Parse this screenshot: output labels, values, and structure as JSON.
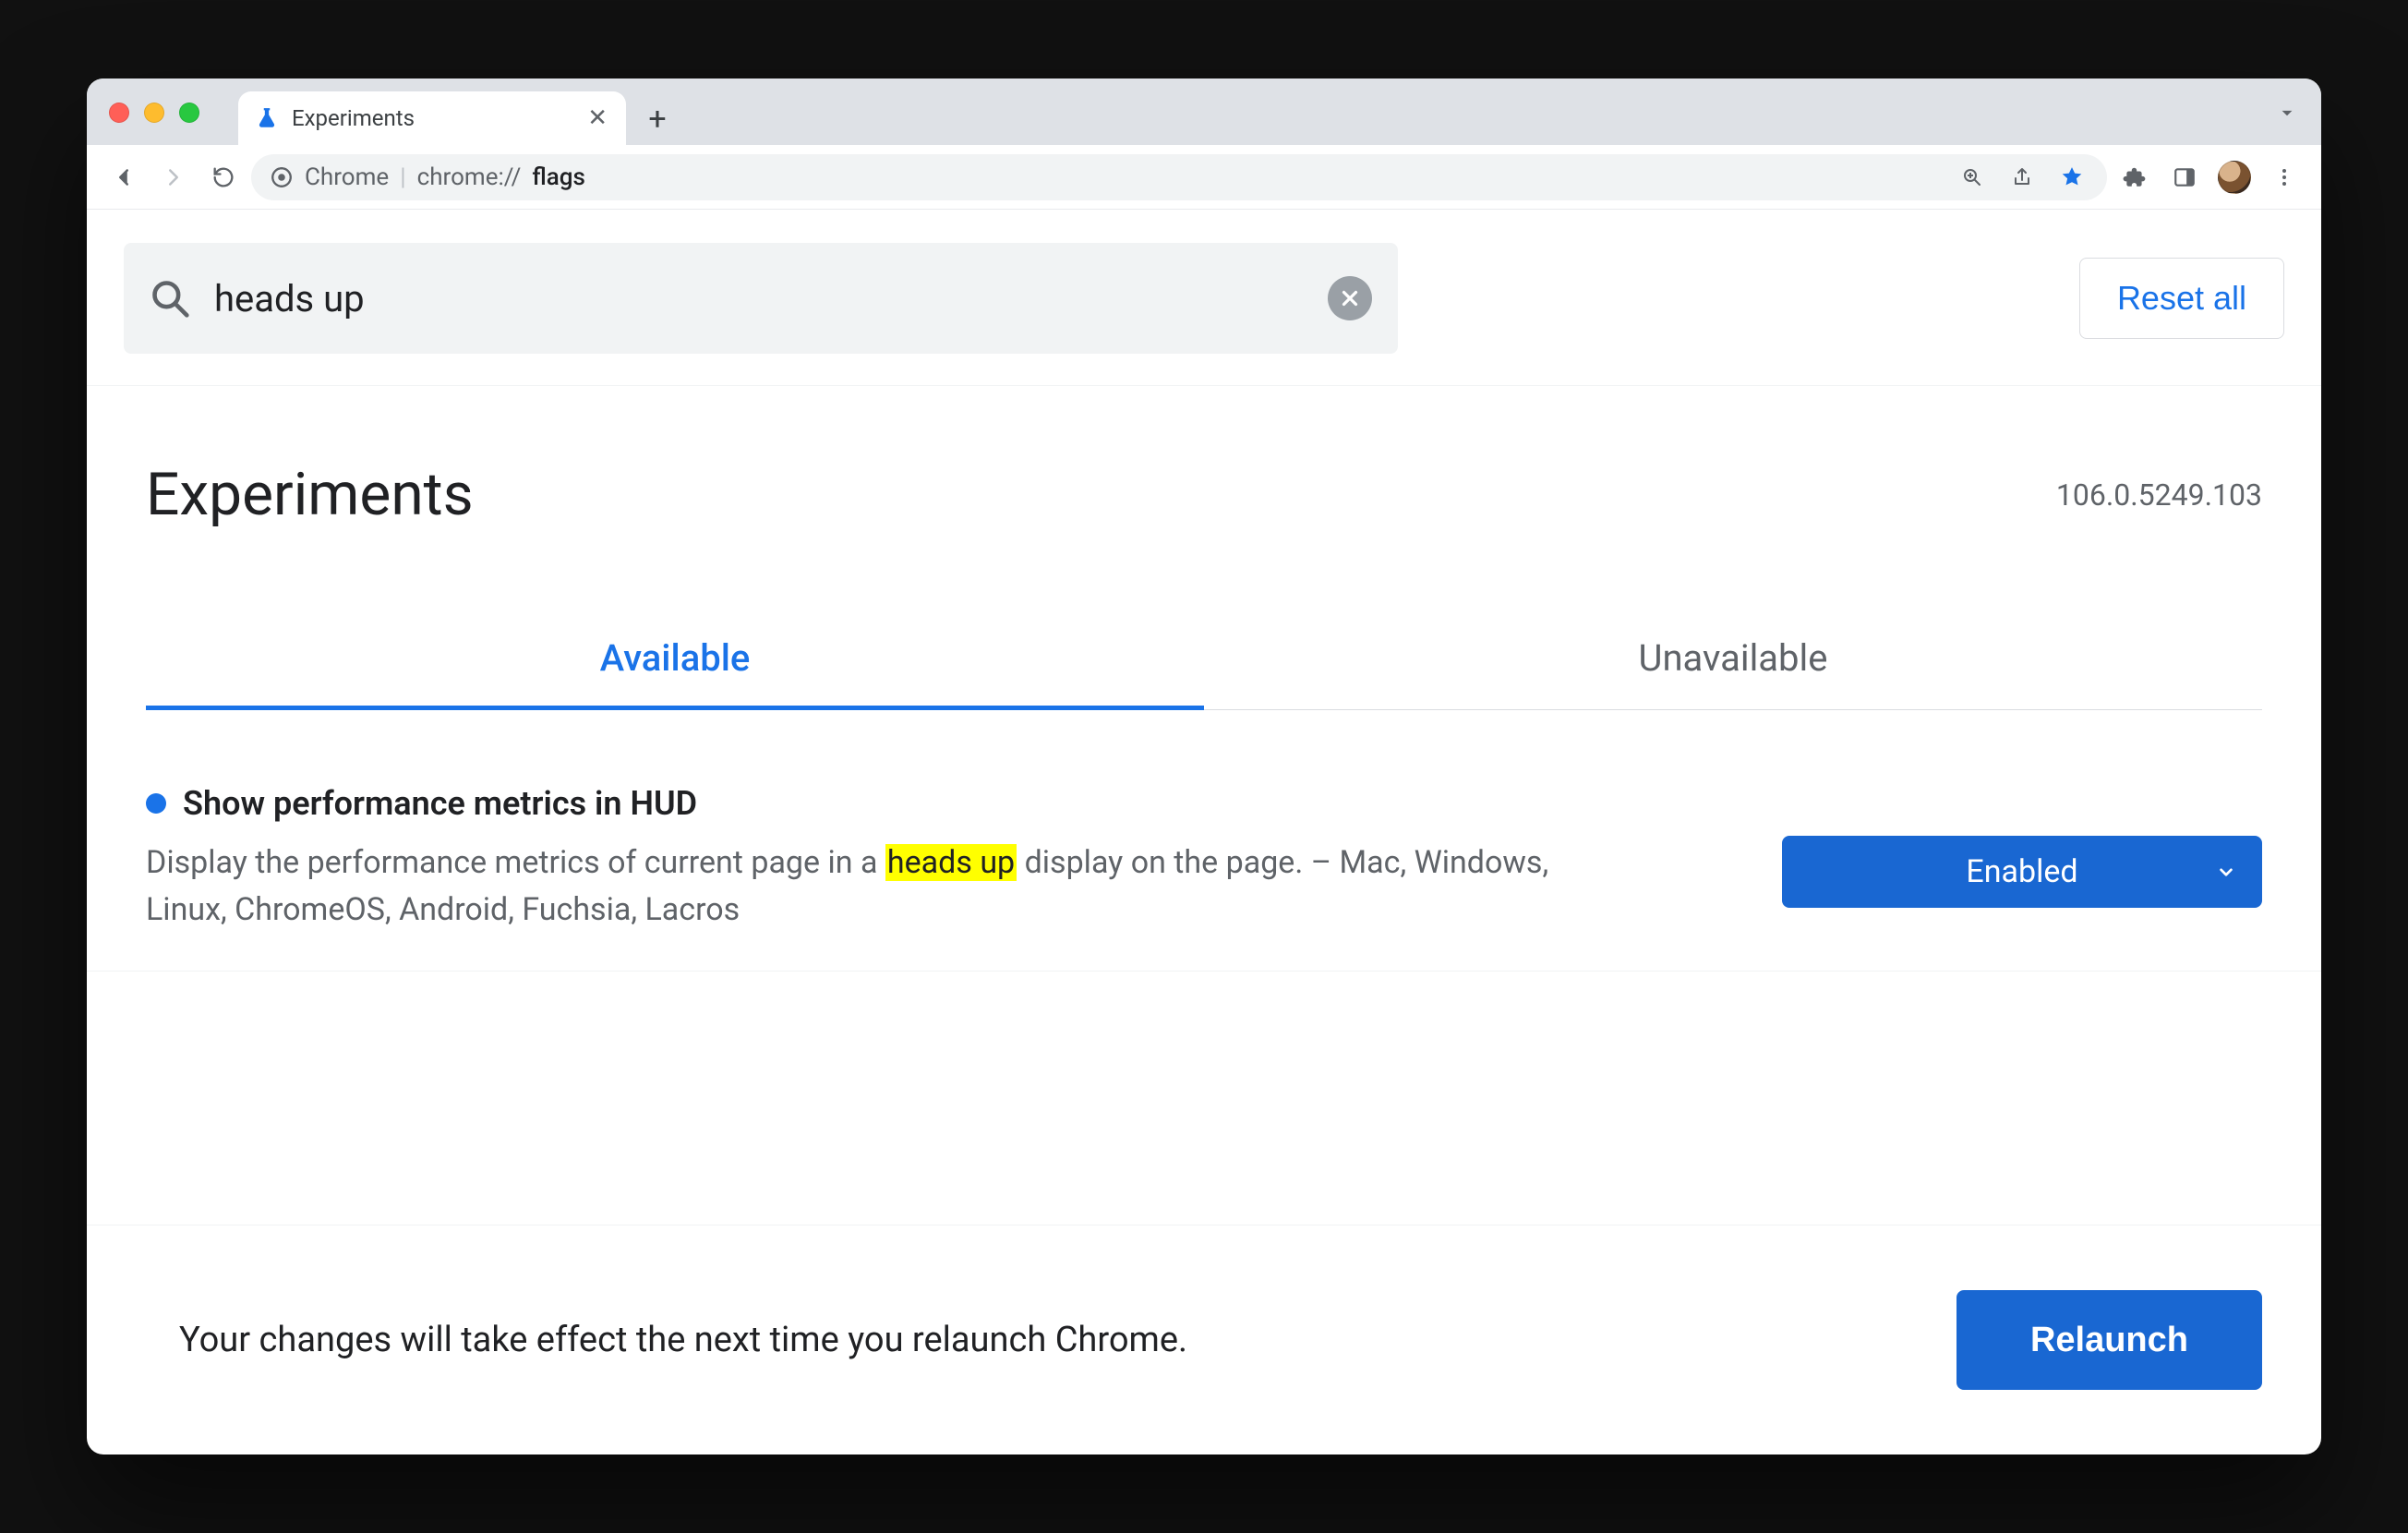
{
  "window": {
    "tab_title": "Experiments"
  },
  "omnibox": {
    "site_label": "Chrome",
    "url_prefix": "chrome://",
    "url_path": "flags"
  },
  "search": {
    "value": "heads up",
    "reset_label": "Reset all"
  },
  "header": {
    "title": "Experiments",
    "version": "106.0.5249.103"
  },
  "tabs": [
    {
      "label": "Available",
      "active": true
    },
    {
      "label": "Unavailable",
      "active": false
    }
  ],
  "flag": {
    "title": "Show performance metrics in HUD",
    "desc_before": "Display the performance metrics of current page in a ",
    "desc_highlight": "heads up",
    "desc_after": " display on the page. – Mac, Windows, Linux, ChromeOS, Android, Fuchsia, Lacros",
    "select_value": "Enabled"
  },
  "relaunch": {
    "message": "Your changes will take effect the next time you relaunch Chrome.",
    "button": "Relaunch"
  }
}
